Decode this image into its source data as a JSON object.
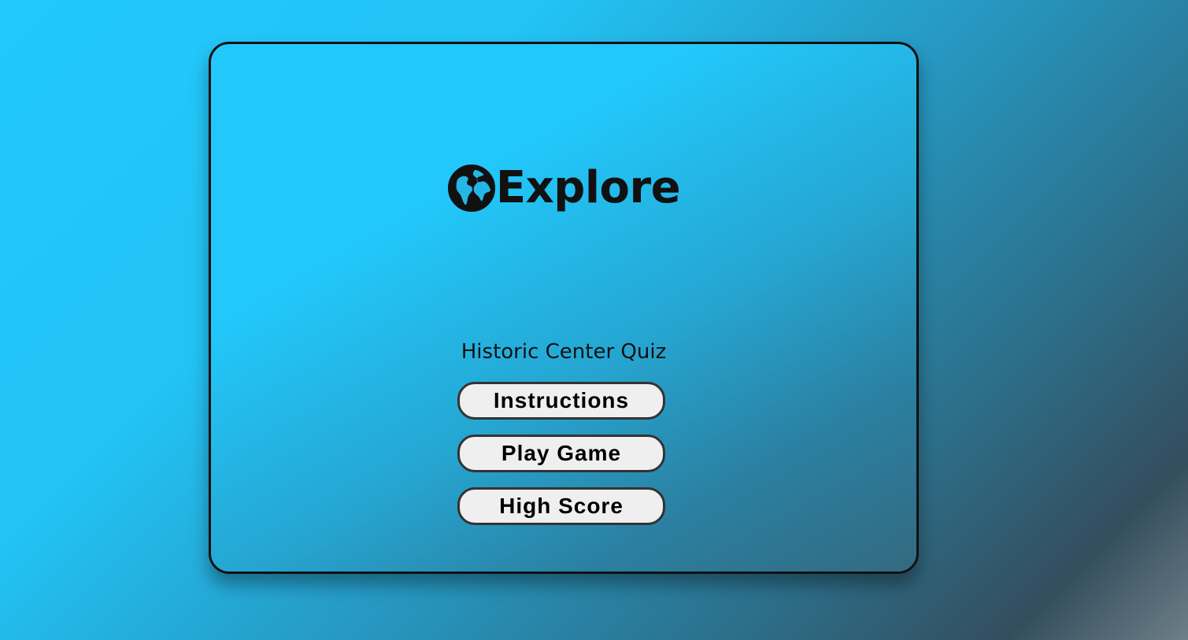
{
  "logo": {
    "icon": "globe-icon",
    "text": "Explore"
  },
  "subtitle": "Historic Center Quiz",
  "menu": {
    "instructions_label": "Instructions",
    "play_label": "Play Game",
    "high_score_label": "High Score"
  },
  "colors": {
    "background_start": "#22c8fb",
    "background_end": "#6e7f88",
    "card_border": "#111111",
    "button_bg": "#efefef",
    "text": "#111111"
  }
}
